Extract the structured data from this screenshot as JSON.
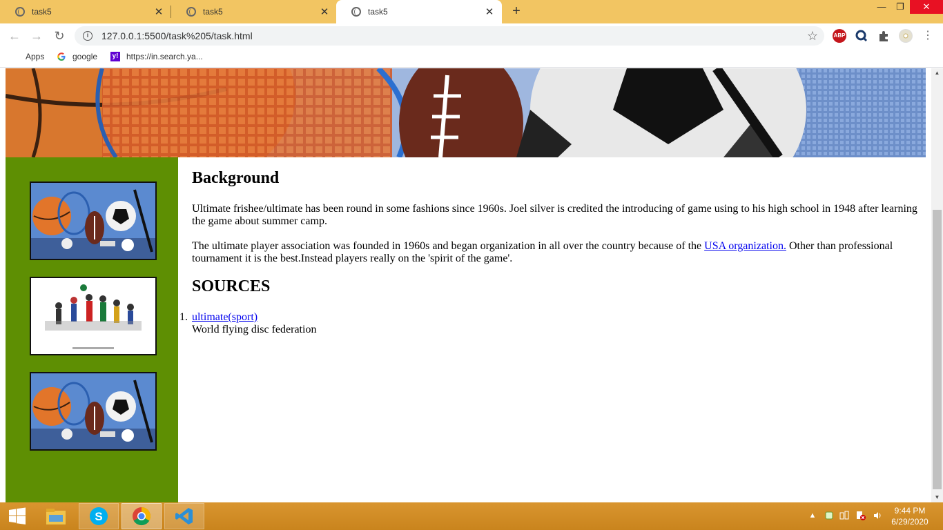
{
  "browser": {
    "tabs": [
      {
        "title": "task5",
        "active": false
      },
      {
        "title": "task5",
        "active": false
      },
      {
        "title": "task5",
        "active": true
      }
    ],
    "new_tab_glyph": "+",
    "url": "127.0.0.1:5500/task%205/task.html",
    "bookmarks": [
      {
        "label": "Apps",
        "icon": "apps-grid-icon"
      },
      {
        "label": "google",
        "icon": "google-icon"
      },
      {
        "label": "https://in.search.ya...",
        "icon": "yahoo-icon"
      }
    ],
    "extensions": [
      "adblock-plus-icon",
      "search-extension-icon",
      "puzzle-extensions-icon",
      "profile-avatar-icon"
    ],
    "adblock_label": "ABP"
  },
  "page": {
    "sections": {
      "background": {
        "heading": "Background",
        "paragraph1": "Ultimate frishee/ultimate has been round in some fashions since 1960s. Joel silver is credited the introducing of game using to his high school in 1948 after learning the game about summer camp.",
        "paragraph2_before": "The ultimate player association was founded in 1960s and began organization in all over the country because of the ",
        "paragraph2_link": "USA organization.",
        "paragraph2_after": " Other than professional tournament it is the best.Instead players really on the 'spirit of the game'."
      },
      "sources": {
        "heading": "SOURCES",
        "items": [
          {
            "number": "1.",
            "link": "ultimate(sport)",
            "text": "World flying disc federation"
          }
        ]
      }
    },
    "sidebar_images": [
      "sports-balls-image",
      "athletes-collage-image",
      "sports-balls-image"
    ]
  },
  "taskbar": {
    "apps": [
      "file-explorer-icon",
      "skype-icon",
      "chrome-icon",
      "vscode-icon"
    ],
    "active_app": "chrome-icon",
    "clock_time": "9:44 PM",
    "clock_date": "6/29/2020"
  },
  "colors": {
    "tabstrip": "#f2c562",
    "sidebar": "#5e8f03",
    "link": "#0000ee",
    "taskbar": "#d08b24"
  }
}
